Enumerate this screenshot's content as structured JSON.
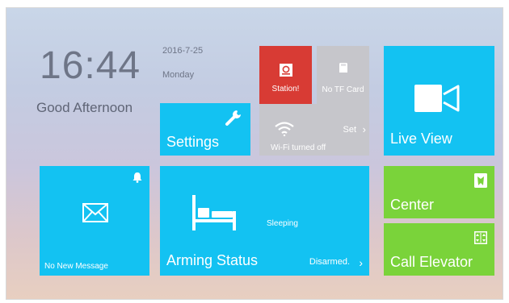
{
  "clock": {
    "time": "16:44",
    "date": "2016-7-25",
    "weekday": "Monday",
    "greeting": "Good Afternoon"
  },
  "tiles": {
    "station": {
      "label": "Station!",
      "color": "#d83b34"
    },
    "tfcard": {
      "label": "No TF Card"
    },
    "settings": {
      "label": "Settings"
    },
    "wifi": {
      "label": "Wi-Fi turned off",
      "action": "Set"
    },
    "live_view": {
      "label": "Live View"
    },
    "message": {
      "label": "No New Message"
    },
    "arming": {
      "label": "Arming Status",
      "state": "Sleeping",
      "status": "Disarmed."
    },
    "center": {
      "label": "Center"
    },
    "elevator": {
      "label": "Call Elevator"
    }
  },
  "colors": {
    "blue": "#13c2f2",
    "green": "#7ad33a",
    "red": "#d83b34",
    "gray": "#c6c6cb"
  }
}
